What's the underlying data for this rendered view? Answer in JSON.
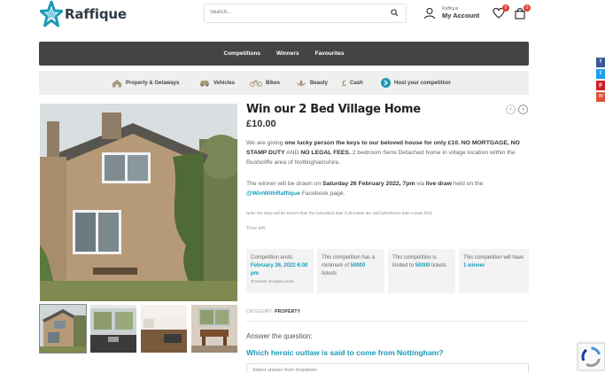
{
  "header": {
    "logo_text": "Raffique",
    "search_placeholder": "Search...",
    "account_small": "Raffique",
    "account_big": "My Account",
    "wishlist_count": "0",
    "cart_count": "0"
  },
  "mainnav": [
    "Competitions",
    "Winners",
    "Favourites"
  ],
  "categories": [
    "Property & Getaways",
    "Vehicles",
    "Bikes",
    "Beauty",
    "Cash",
    "Host your competition"
  ],
  "product": {
    "title": "Win our 2 Bed Village Home",
    "price": "£10.00",
    "desc_1": "We are giving ",
    "desc_b1": "one lucky person the keys to our beloved house for only £10. NO MORTGAGE, NO STAMP DUTY",
    "desc_2": " AND ",
    "desc_b2": "NO LEGAL FEES.",
    "desc_3": " 2 bedroom Semi Detached home in village location within the Rushcliffe area of Nottinghamshire.",
    "draw_1": "The winner will be drawn on ",
    "draw_b1": "Saturday 26 February 2022, 7pm",
    "draw_2": " via ",
    "draw_b2": "live draw",
    "draw_3": " held on the ",
    "draw_hashtag": "@WinWithRaffique",
    "draw_4": " Facebook page.",
    "note": "Note: the draw will be sooner than the scheduled date if all tickets are sold (whichever date comes first)",
    "time_left": "Time left:"
  },
  "cards": {
    "c1_label": "Competition ends:",
    "c1_value": "February 26, 2022 6:00 pm",
    "c1_tz": "Timezone: Europe/London",
    "c2_a": "This competition has a minimum of ",
    "c2_value": "50000",
    "c2_b": " tickets",
    "c3_a": "This competition is limited to ",
    "c3_value": "50000",
    "c3_b": " tickets",
    "c4_a": "This competition will have ",
    "c4_value": "1 winner"
  },
  "category": {
    "label": "CATEGORY:",
    "value": "PROPERTY"
  },
  "question": {
    "label": "Answer the question:",
    "text": "Which heroic outlaw is said to come from Nottingham?",
    "select_placeholder": "Select answer from dropdown"
  },
  "social": [
    "f",
    "t",
    "p",
    "✉"
  ],
  "colors": {
    "accent": "#1a9bb8",
    "nav_bg": "#444444",
    "badge": "#e23d3d"
  }
}
